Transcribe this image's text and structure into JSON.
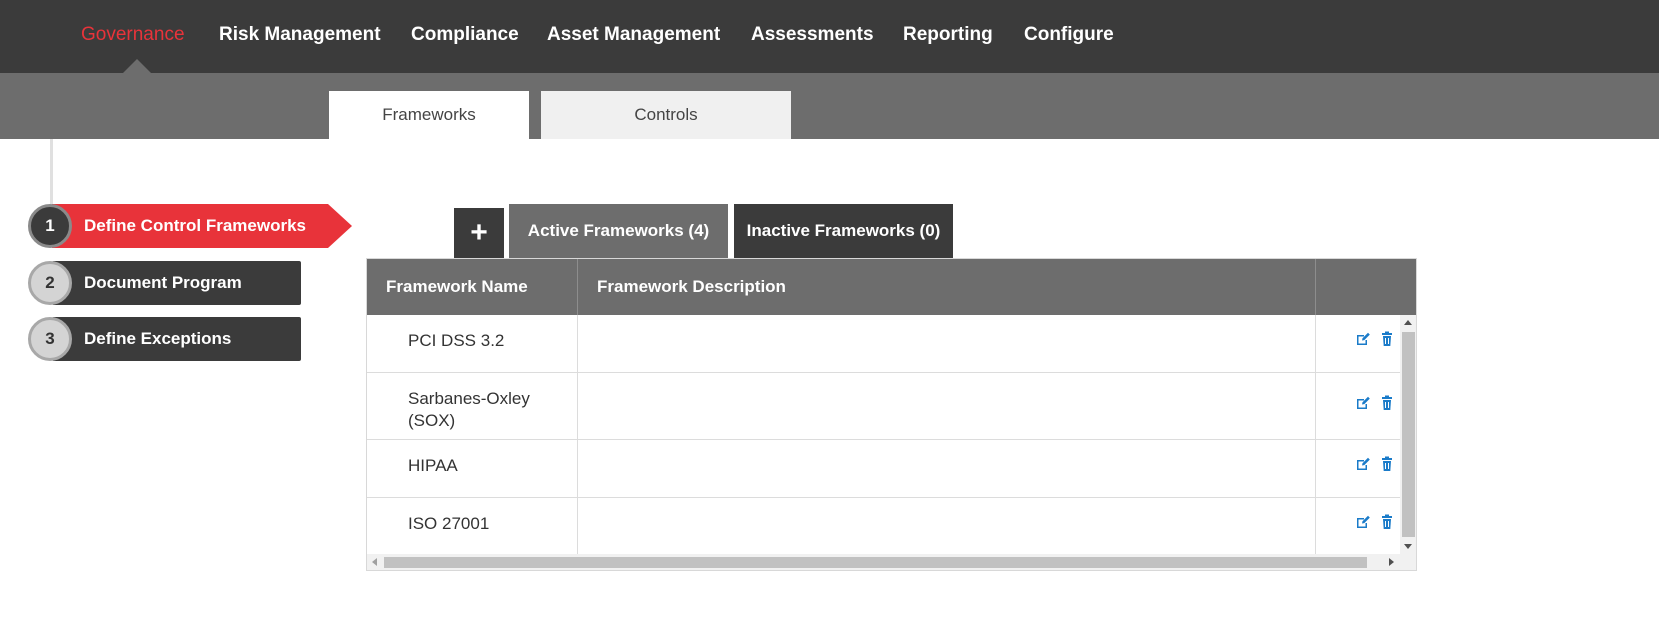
{
  "topnav": {
    "items": [
      {
        "label": "Governance",
        "active": true
      },
      {
        "label": "Risk Management"
      },
      {
        "label": "Compliance"
      },
      {
        "label": "Asset Management"
      },
      {
        "label": "Assessments"
      },
      {
        "label": "Reporting"
      },
      {
        "label": "Configure"
      }
    ]
  },
  "subtabs": {
    "frameworks": "Frameworks",
    "controls": "Controls",
    "active": "Frameworks"
  },
  "steps": [
    {
      "number": "1",
      "label": "Define Control Frameworks",
      "active": true
    },
    {
      "number": "2",
      "label": "Document Program"
    },
    {
      "number": "3",
      "label": "Define Exceptions"
    }
  ],
  "framework_tabs": {
    "add": "+",
    "active_label": "Active Frameworks (4)",
    "inactive_label": "Inactive Frameworks (0)"
  },
  "table": {
    "headers": [
      "Framework Name",
      "Framework Description",
      ""
    ],
    "rows": [
      {
        "name": "PCI DSS 3.2",
        "description": ""
      },
      {
        "name": "Sarbanes-Oxley (SOX)",
        "description": ""
      },
      {
        "name": "HIPAA",
        "description": ""
      },
      {
        "name": "ISO 27001",
        "description": ""
      }
    ],
    "action_icons": [
      "edit-icon",
      "trash-icon"
    ]
  },
  "colors": {
    "nav_bg": "#3b3b3b",
    "accent_red": "#e8333a",
    "subbar_bg": "#6d6d6d",
    "action_blue": "#1a7bc9"
  }
}
